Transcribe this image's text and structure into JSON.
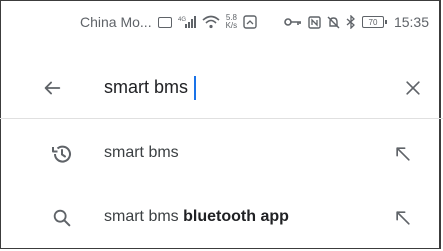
{
  "status_bar": {
    "carrier": "China Mo...",
    "network_type": "4G",
    "speed_value": "5.8",
    "speed_unit": "K/s",
    "battery": "70",
    "time": "15:35"
  },
  "search": {
    "query": "smart bms",
    "back_icon": "arrow-back-icon",
    "clear_icon": "close-icon"
  },
  "suggestions": [
    {
      "icon": "history-icon",
      "text_plain": "smart bms",
      "text_bold": "",
      "action_icon": "arrow-up-left-icon"
    },
    {
      "icon": "search-icon",
      "text_plain": "smart bms ",
      "text_bold": "bluetooth app",
      "action_icon": "arrow-up-left-icon"
    }
  ],
  "colors": {
    "accent": "#1a73e8",
    "icon": "#5f6368",
    "text": "#202124",
    "divider": "#e0e0e0"
  }
}
